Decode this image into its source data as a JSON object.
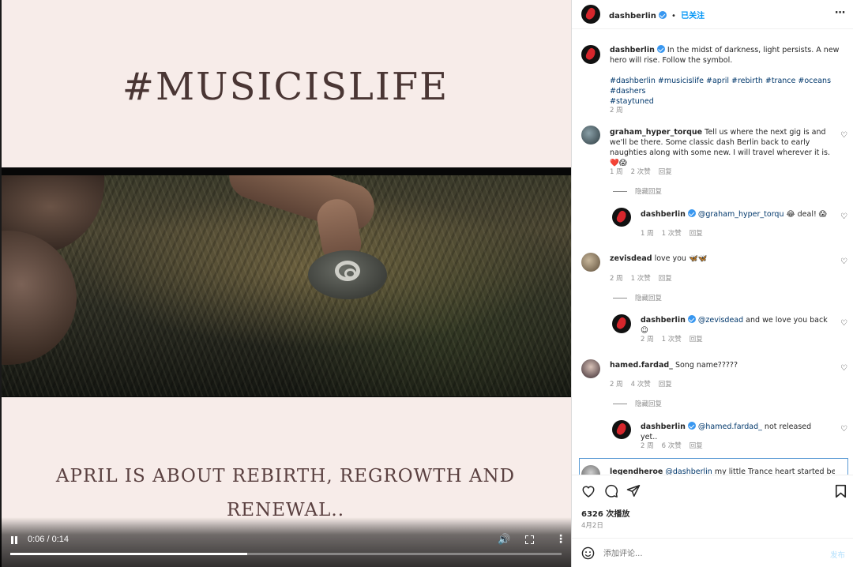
{
  "media": {
    "hashtag_title": "#MUSICISLIFE",
    "tagline_line1": "APRIL IS ABOUT REBIRTH, REGROWTH AND",
    "tagline_line2": "RENEWAL..",
    "time": "0:06 / 0:14",
    "progress": 0.43
  },
  "header": {
    "username": "dashberlin",
    "dot": "•",
    "follow_label": "已关注",
    "more_icon": "more-horizontal-icon"
  },
  "caption": {
    "username": "dashberlin",
    "text": "In the midst of darkness, light persists. A new hero will rise. Follow the symbol.",
    "hashtags_line1": "#dashberlin #musicislife #april #rebirth #trance #oceans #dashers",
    "hashtags_line2": "#staytuned",
    "time": "2 周"
  },
  "comments": [
    {
      "username": "graham_hyper_torque",
      "text": "Tell us where the next gig is and we'll be there. Some classic dash Berlin back to early naughties along with some new. I will travel wherever it is. ❤️😱",
      "time": "1 周",
      "likes": "2 次赞",
      "reply": "回复",
      "hide_replies": "隐藏回复",
      "reply_item": {
        "username": "dashberlin",
        "mention": "@graham_hyper_torqu",
        "text": " 😂 deal! 😱",
        "time": "1 周",
        "likes": "1 次赞",
        "reply": "回复"
      }
    },
    {
      "username": "zevisdead",
      "text": "love you 🦋🦋",
      "time": "2 周",
      "likes": "1 次赞",
      "reply": "回复",
      "hide_replies": "隐藏回复",
      "reply_item": {
        "username": "dashberlin",
        "mention": "@zevisdead",
        "text": " and we love you back ☺",
        "time": "2 周",
        "likes": "1 次赞",
        "reply": "回复"
      }
    },
    {
      "username": "hamed.fardad_",
      "text": "Song name?????",
      "time": "2 周",
      "likes": "4 次赞",
      "reply": "回复",
      "hide_replies": "隐藏回复",
      "reply_item": {
        "username": "dashberlin",
        "mention": "@hamed.fardad_",
        "text": " not released yet..",
        "time": "2 周",
        "likes": "6 次赞",
        "reply": "回复"
      }
    },
    {
      "username": "legendheroe",
      "mention": "@dashberlin",
      "text": " my little Trance heart started beating"
    }
  ],
  "actions": {
    "views": "6326 次播放",
    "date": "4月2日"
  },
  "add_comment": {
    "placeholder": "添加评论...",
    "post_label": "发布"
  },
  "colors": {
    "accent": "#0095f6",
    "verified": "#3897f0",
    "brand": "#d6262c"
  }
}
